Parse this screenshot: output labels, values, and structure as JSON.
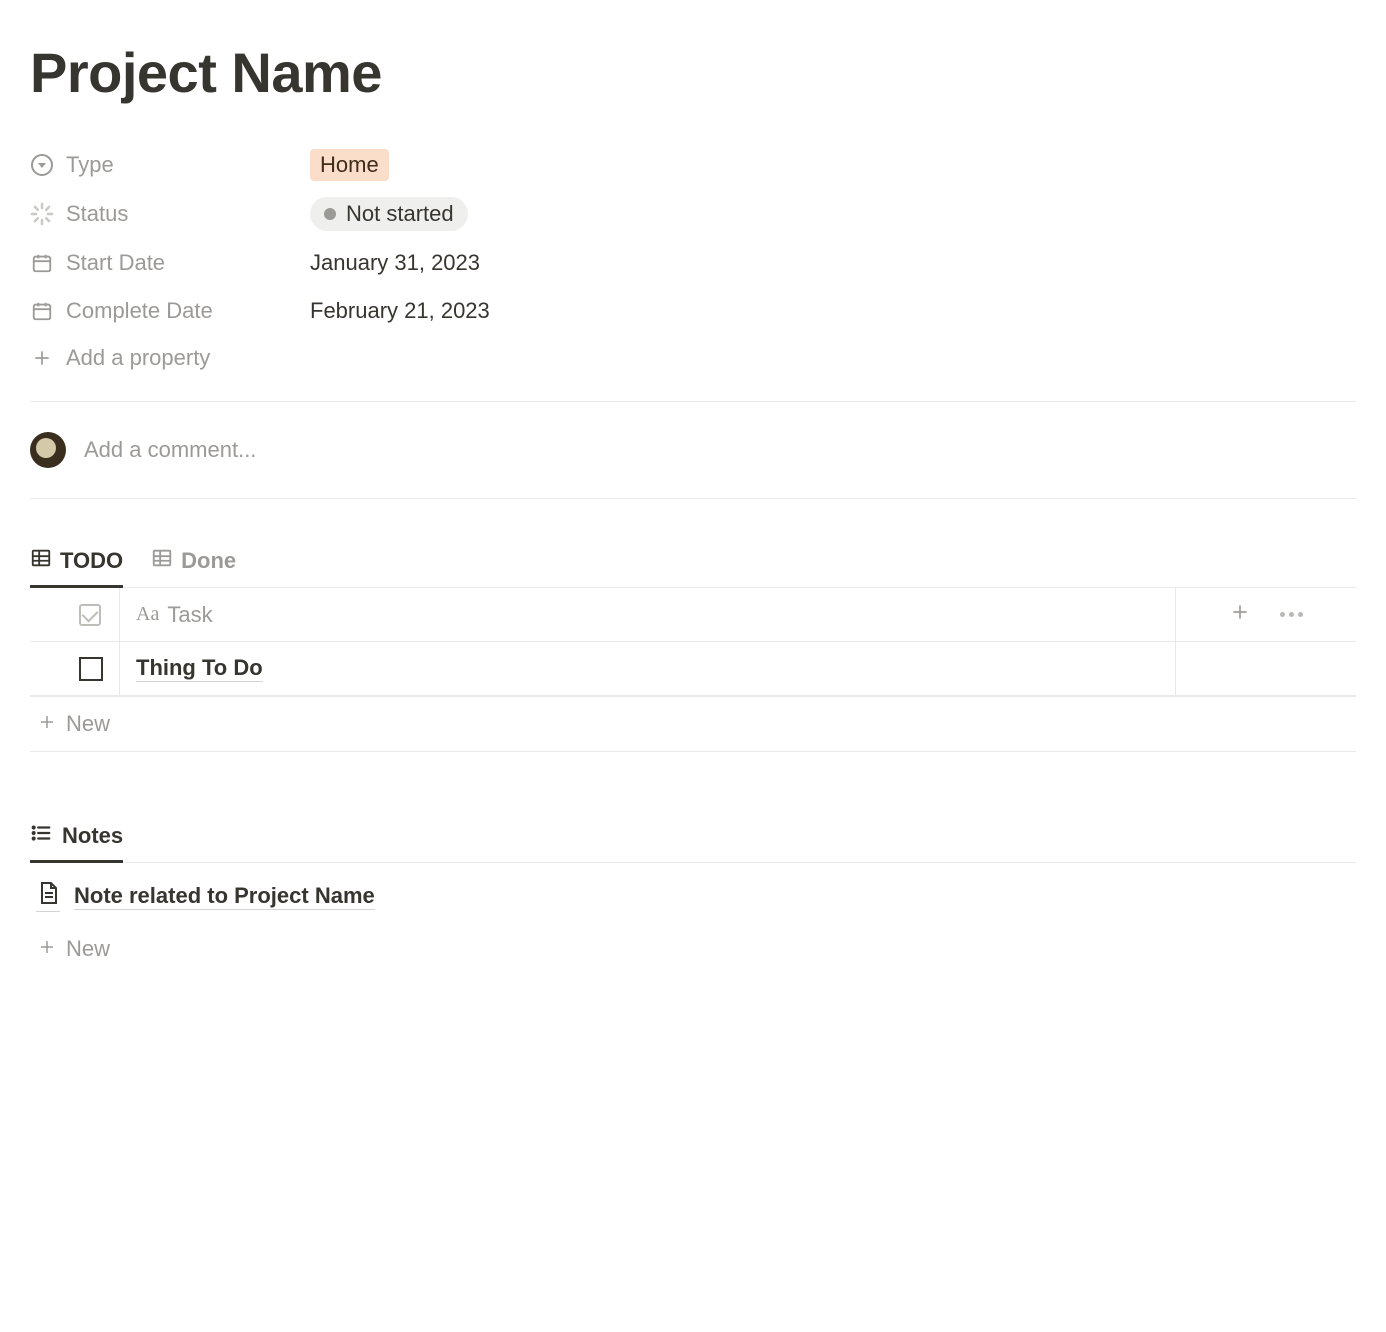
{
  "page": {
    "title": "Project Name"
  },
  "properties": {
    "type": {
      "label": "Type",
      "value": "Home"
    },
    "status": {
      "label": "Status",
      "value": "Not started"
    },
    "start_date": {
      "label": "Start Date",
      "value": "January 31, 2023"
    },
    "complete_date": {
      "label": "Complete Date",
      "value": "February 21, 2023"
    },
    "add_label": "Add a property"
  },
  "comment": {
    "placeholder": "Add a comment..."
  },
  "todo": {
    "tabs": {
      "todo": "TODO",
      "done": "Done"
    },
    "column_header": "Task",
    "rows": [
      {
        "title": "Thing To Do"
      }
    ],
    "new_label": "New"
  },
  "notes": {
    "tab_label": "Notes",
    "items": [
      {
        "title": "Note related to Project Name"
      }
    ],
    "new_label": "New"
  }
}
